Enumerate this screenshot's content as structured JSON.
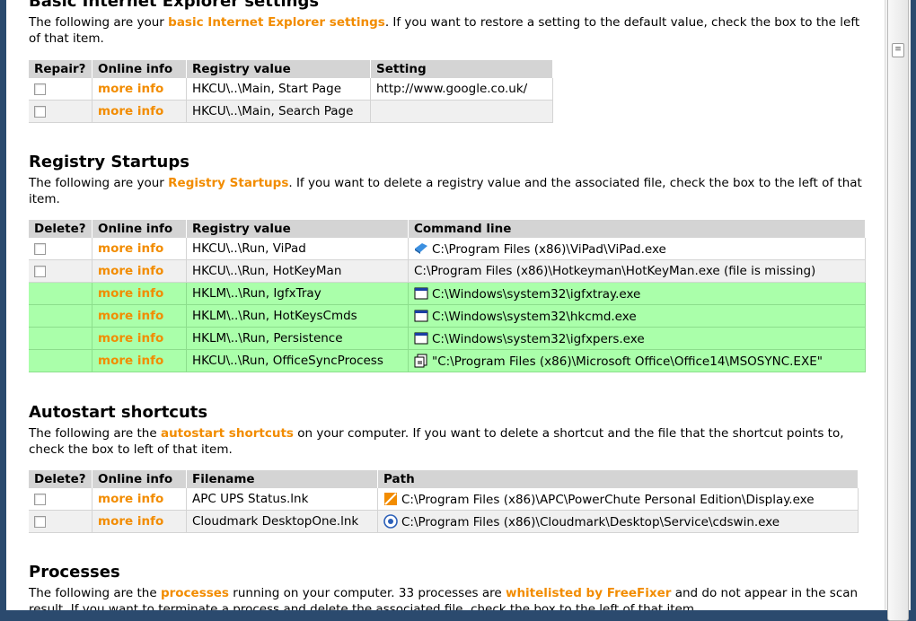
{
  "ie_section": {
    "title": "Basic Internet Explorer settings",
    "desc_pre": "The following are your ",
    "desc_link": "basic Internet Explorer settings",
    "desc_post": ". If you want to restore a setting to the default value, check the box to the left of that item.",
    "headers": [
      "Repair?",
      "Online info",
      "Registry value",
      "Setting"
    ],
    "rows": [
      {
        "info": "more info",
        "registry": "HKCU\\..\\Main, Start Page",
        "setting": "http://www.google.co.uk/"
      },
      {
        "info": "more info",
        "registry": "HKCU\\..\\Main, Search Page",
        "setting": ""
      }
    ]
  },
  "startups_section": {
    "title": "Registry Startups",
    "desc_pre": "The following are your ",
    "desc_link": "Registry Startups",
    "desc_post": ". If you want to delete a registry value and the associated file, check the box to the left of that item.",
    "headers": [
      "Delete?",
      "Online info",
      "Registry value",
      "Command line"
    ],
    "rows": [
      {
        "info": "more info",
        "registry": "HKCU\\..\\Run, ViPad",
        "command": "C:\\Program Files (x86)\\ViPad\\ViPad.exe",
        "icon": "vipad-icon"
      },
      {
        "info": "more info",
        "registry": "HKCU\\..\\Run, HotKeyMan",
        "command": "C:\\Program Files (x86)\\Hotkeyman\\HotKeyMan.exe (file is missing)",
        "icon": ""
      },
      {
        "info": "more info",
        "registry": "HKLM\\..\\Run, IgfxTray",
        "command": "C:\\Windows\\system32\\igfxtray.exe",
        "icon": "window-app-icon"
      },
      {
        "info": "more info",
        "registry": "HKLM\\..\\Run, HotKeysCmds",
        "command": "C:\\Windows\\system32\\hkcmd.exe",
        "icon": "window-app-icon"
      },
      {
        "info": "more info",
        "registry": "HKLM\\..\\Run, Persistence",
        "command": "C:\\Windows\\system32\\igfxpers.exe",
        "icon": "window-app-icon"
      },
      {
        "info": "more info",
        "registry": "HKCU\\..\\Run, OfficeSyncProcess",
        "command": "\"C:\\Program Files (x86)\\Microsoft Office\\Office14\\MSOSYNC.EXE\"",
        "icon": "office-sync-icon"
      }
    ]
  },
  "shortcuts_section": {
    "title": "Autostart shortcuts",
    "desc_pre": "The following are the ",
    "desc_link": "autostart shortcuts",
    "desc_post": " on your computer. If you want to delete a shortcut and the file that the shortcut points to, check the box to left of that item.",
    "headers": [
      "Delete?",
      "Online info",
      "Filename",
      "Path"
    ],
    "rows": [
      {
        "info": "more info",
        "filename": "APC UPS Status.lnk",
        "path": "C:\\Program Files (x86)\\APC\\PowerChute Personal Edition\\Display.exe",
        "icon": "apc-icon"
      },
      {
        "info": "more info",
        "filename": "Cloudmark DesktopOne.lnk",
        "path": "C:\\Program Files (x86)\\Cloudmark\\Desktop\\Service\\cdswin.exe",
        "icon": "cloudmark-icon"
      }
    ]
  },
  "processes_section": {
    "title": "Processes",
    "desc_pre": "The following are the ",
    "desc_link": "processes",
    "desc_mid": " running on your computer. 33 processes are ",
    "desc_link2": "whitelisted by FreeFixer",
    "desc_post": " and do not appear in the scan result. If you want to terminate a process and delete the associated file, check the box to the left of that item."
  },
  "colors": {
    "accent": "#f28c00",
    "whitelisted_row": "#aaffaa",
    "header_bg": "#d4d4d4"
  }
}
